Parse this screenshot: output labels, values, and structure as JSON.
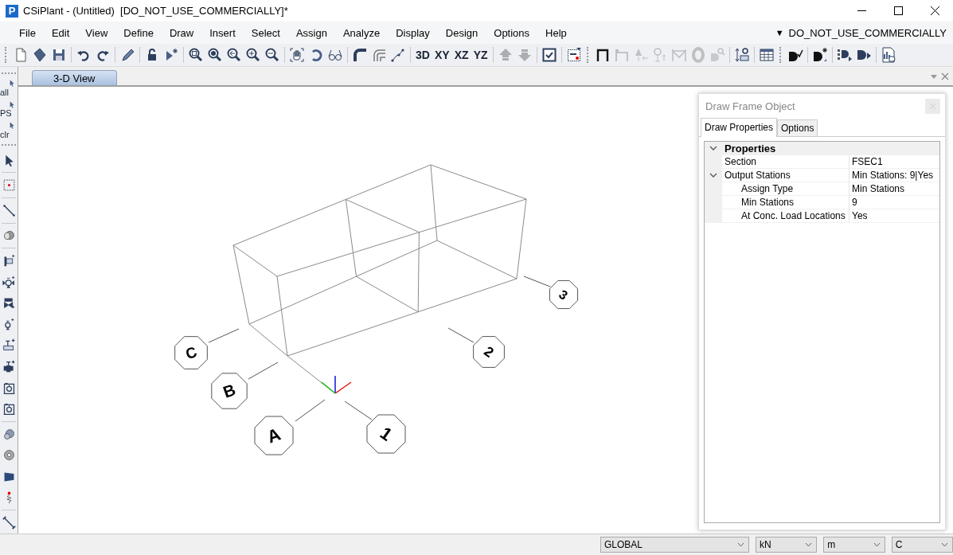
{
  "window": {
    "logo": "P",
    "title": "CSiPlant - (Untitled)  [DO_NOT_USE_COMMERCIALLY]*"
  },
  "menu": {
    "items": [
      "File",
      "Edit",
      "View",
      "Define",
      "Draw",
      "Insert",
      "Select",
      "Assign",
      "Analyze",
      "Display",
      "Design",
      "Options",
      "Help"
    ],
    "license_marker": "▼",
    "license": "DO_NOT_USE_COMMERCIALLY"
  },
  "toolbar": [
    {
      "kind": "grip"
    },
    {
      "kind": "icon",
      "disabled": false
    },
    {
      "kind": "icon",
      "disabled": false
    },
    {
      "kind": "icon",
      "disabled": false
    },
    {
      "kind": "sep"
    },
    {
      "kind": "icon",
      "disabled": false
    },
    {
      "kind": "icon",
      "disabled": false
    },
    {
      "kind": "sep"
    },
    {
      "kind": "icon",
      "disabled": false
    },
    {
      "kind": "sep"
    },
    {
      "kind": "icon",
      "disabled": false
    },
    {
      "kind": "icon",
      "disabled": false
    },
    {
      "kind": "sep"
    },
    {
      "kind": "icon",
      "disabled": false
    },
    {
      "kind": "icon",
      "disabled": false
    },
    {
      "kind": "icon",
      "disabled": false
    },
    {
      "kind": "icon",
      "disabled": false
    },
    {
      "kind": "icon",
      "disabled": false
    },
    {
      "kind": "sep"
    },
    {
      "kind": "icon",
      "disabled": false
    },
    {
      "kind": "icon",
      "disabled": false
    },
    {
      "kind": "icon",
      "disabled": false
    },
    {
      "kind": "sep"
    },
    {
      "kind": "icon",
      "disabled": false
    },
    {
      "kind": "icon",
      "disabled": false
    },
    {
      "kind": "icon",
      "disabled": false
    },
    {
      "kind": "sep"
    },
    {
      "kind": "text",
      "label": "3D"
    },
    {
      "kind": "text",
      "label": "XY"
    },
    {
      "kind": "text",
      "label": "XZ"
    },
    {
      "kind": "text",
      "label": "YZ"
    },
    {
      "kind": "sep"
    },
    {
      "kind": "icon",
      "disabled": true
    },
    {
      "kind": "icon",
      "disabled": true
    },
    {
      "kind": "sep"
    },
    {
      "kind": "icon",
      "disabled": false
    },
    {
      "kind": "sep"
    },
    {
      "kind": "icon",
      "disabled": false
    },
    {
      "kind": "grip"
    },
    {
      "kind": "icon",
      "disabled": false
    },
    {
      "kind": "icon",
      "disabled": true
    },
    {
      "kind": "icon",
      "disabled": true
    },
    {
      "kind": "icon",
      "disabled": true
    },
    {
      "kind": "icon",
      "disabled": true
    },
    {
      "kind": "icon",
      "disabled": true
    },
    {
      "kind": "icon",
      "disabled": true
    },
    {
      "kind": "sep"
    },
    {
      "kind": "icon",
      "disabled": false
    },
    {
      "kind": "sep"
    },
    {
      "kind": "icon",
      "disabled": false
    },
    {
      "kind": "grip"
    },
    {
      "kind": "icon",
      "disabled": false
    },
    {
      "kind": "sep"
    },
    {
      "kind": "icon",
      "disabled": false
    },
    {
      "kind": "sep"
    },
    {
      "kind": "icon",
      "disabled": false
    },
    {
      "kind": "icon",
      "disabled": false
    },
    {
      "kind": "sep"
    },
    {
      "kind": "icon",
      "disabled": false
    }
  ],
  "view_tabs": [
    {
      "label": "3-D View",
      "selected": true
    }
  ],
  "side_toolbar": [
    {
      "kind": "grip"
    },
    {
      "kind": "text",
      "label": "all"
    },
    {
      "kind": "text",
      "label": "PS"
    },
    {
      "kind": "text",
      "label": "clr"
    },
    {
      "kind": "grip"
    },
    {
      "kind": "icon"
    },
    {
      "kind": "sep"
    },
    {
      "kind": "icon"
    },
    {
      "kind": "sep"
    },
    {
      "kind": "icon"
    },
    {
      "kind": "sep"
    },
    {
      "kind": "icon"
    },
    {
      "kind": "sep"
    },
    {
      "kind": "icon"
    },
    {
      "kind": "icon"
    },
    {
      "kind": "icon"
    },
    {
      "kind": "icon"
    },
    {
      "kind": "icon"
    },
    {
      "kind": "icon"
    },
    {
      "kind": "icon"
    },
    {
      "kind": "icon"
    },
    {
      "kind": "sep"
    },
    {
      "kind": "icon"
    },
    {
      "kind": "icon"
    },
    {
      "kind": "icon"
    },
    {
      "kind": "icon"
    },
    {
      "kind": "sep"
    },
    {
      "kind": "icon"
    }
  ],
  "grid_bubbles": [
    {
      "label": "A"
    },
    {
      "label": "B"
    },
    {
      "label": "C"
    },
    {
      "label": "1"
    },
    {
      "label": "2"
    },
    {
      "label": "3"
    }
  ],
  "panel": {
    "title": "Draw Frame Object",
    "tabs": [
      {
        "label": "Draw Properties",
        "selected": true
      },
      {
        "label": "Options",
        "selected": false
      }
    ],
    "properties": [
      {
        "kind": "category",
        "label": "Properties",
        "expanded": true,
        "children": [
          {
            "kind": "property",
            "label": "Section",
            "value": "FSEC1"
          },
          {
            "kind": "property",
            "label": "Output Stations",
            "value": "Min Stations: 9|Yes",
            "expanded": true,
            "children": [
              {
                "kind": "property",
                "label": "Assign Type",
                "value": "Min Stations"
              },
              {
                "kind": "property",
                "label": "Min Stations",
                "value": "9"
              },
              {
                "kind": "property",
                "label": "At Conc. Load Locations",
                "value": "Yes"
              }
            ]
          }
        ]
      }
    ]
  },
  "status_bar": {
    "coordinate_system": "GLOBAL",
    "force_unit": "kN",
    "length_unit": "m",
    "temperature_unit": "C"
  }
}
